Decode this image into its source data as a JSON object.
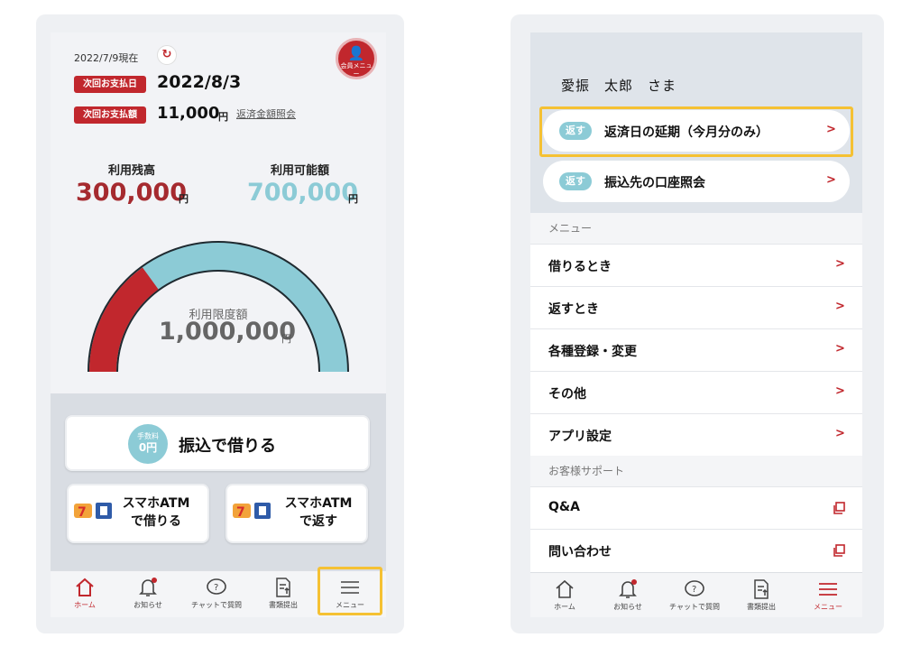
{
  "colors": {
    "accent": "#c1272d",
    "teal": "#8ccbd6",
    "highlight": "#f5c133"
  },
  "home": {
    "as_of": "2022/7/9現在",
    "refresh_icon": "refresh-icon",
    "member_menu": "会員メニュー",
    "next_payment_date_label": "次回お支払日",
    "next_payment_date": "2022/8/3",
    "next_payment_amount_label": "次回お支払額",
    "next_payment_amount": "11,000",
    "yen": "円",
    "repayment_inquiry_link": "返済金額照会",
    "balance_label": "利用残高",
    "balance_value": "300,000",
    "available_label": "利用可能額",
    "available_value": "700,000",
    "limit_label": "利用限度額",
    "limit_value": "1,000,000",
    "gauge": {
      "used": 300000,
      "limit": 1000000
    },
    "fee_badge_label": "手数料",
    "fee_badge_value": "0円",
    "transfer_button": "振込で借りる",
    "atm_borrow_line1": "スマホATM",
    "atm_borrow_line2": "で借りる",
    "atm_return_line1": "スマホATM",
    "atm_return_line2": "で返す"
  },
  "nav": {
    "home": "ホーム",
    "notifications": "お知らせ",
    "chat": "チャットで質問",
    "documents": "書類提出",
    "menu": "メニュー"
  },
  "menu_screen": {
    "user_name": "愛振　太郎　さま",
    "return_badge": "返す",
    "extend_due_date": "返済日の延期（今月分のみ）",
    "account_inquiry": "振込先の口座照会",
    "menu_section": "メニュー",
    "items": [
      "借りるとき",
      "返すとき",
      "各種登録・変更",
      "その他",
      "アプリ設定"
    ],
    "support_section": "お客様サポート",
    "support_items": [
      "Q&A",
      "問い合わせ"
    ],
    "chevron": ">"
  }
}
